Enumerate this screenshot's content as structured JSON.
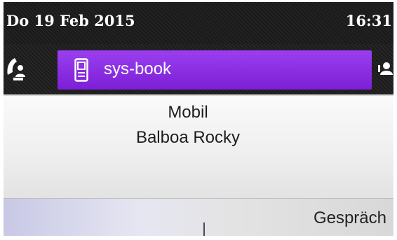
{
  "status": {
    "date": "Do 19 Feb 2015",
    "time": "16:31"
  },
  "tabs": {
    "left_icon": "handset-person-icon",
    "active": {
      "label": "sys-book",
      "icon": "mobile-phone-icon"
    },
    "right_icon": "person-icon",
    "active_color": "#8b2fe6"
  },
  "contact": {
    "type": "Mobil",
    "name": "Balboa Rocky"
  },
  "softkeys": {
    "key1": "",
    "key2": "Gespräch"
  }
}
